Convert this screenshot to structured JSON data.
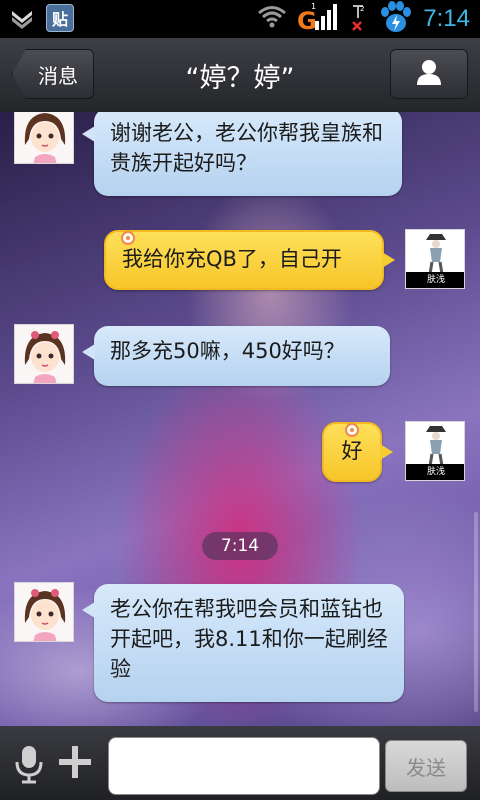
{
  "status_bar": {
    "time": "7:14",
    "paste_icon_label": "贴",
    "icons": [
      "download-icon",
      "paste-icon",
      "wifi-icon",
      "signal-g-icon",
      "signal-2-icon",
      "baidu-paw-icon"
    ]
  },
  "title_bar": {
    "back_label": "消息",
    "title": "“婷？婷”"
  },
  "messages": [
    {
      "side": "in",
      "text": "谢谢老公，老公你帮我皇族和贵族开起好吗？"
    },
    {
      "side": "out",
      "text": "我给你充QB了，自己开",
      "avatar_caption": "肤浅"
    },
    {
      "side": "in",
      "text": "那多充50嘛，450好吗？"
    },
    {
      "side": "out",
      "text": "好",
      "avatar_caption": "肤浅"
    },
    {
      "side": "in",
      "text": "老公你在帮我吧会员和蓝钻也开起吧，我8.11和你一起刷经验"
    }
  ],
  "timestamp": "7:14",
  "input_bar": {
    "send_label": "发送",
    "placeholder": ""
  },
  "colors": {
    "incoming_bubble": "#c6def6",
    "outgoing_bubble": "#f9d23b",
    "status_time": "#3fb8e8"
  }
}
